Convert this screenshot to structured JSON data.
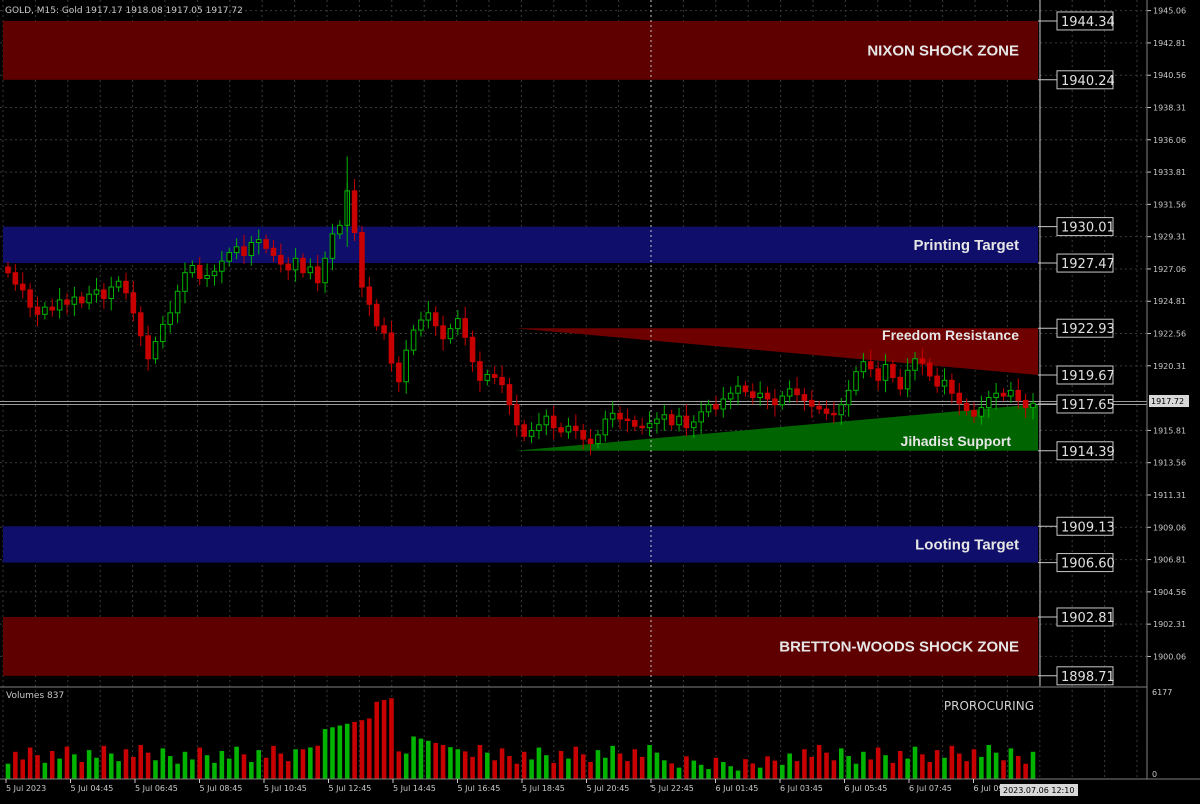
{
  "header": {
    "info": "GOLD, M15:  Gold  1917.17 1918.08 1917.05 1917.72"
  },
  "volume_panel": {
    "label": "Volumes 837",
    "watermark": "PROROCURING",
    "axis_max": "6177",
    "axis_min": "0"
  },
  "time_tag": "2023.07.06 12:10",
  "current_price_tag": "1917.72",
  "chart_data": {
    "type": "candlestick",
    "symbol": "GOLD",
    "timeframe": "M15",
    "ylim": [
      1898.0,
      1945.8
    ],
    "price_ticks": [
      "1945.06",
      "1942.81",
      "1940.56",
      "1938.31",
      "1936.06",
      "1933.81",
      "1931.56",
      "1929.31",
      "1927.06",
      "1924.81",
      "1922.56",
      "1920.31",
      "1915.81",
      "1913.56",
      "1911.31",
      "1909.06",
      "1906.81",
      "1904.56",
      "1902.31",
      "1900.06"
    ],
    "time_ticks": [
      "5 Jul 2023",
      "5 Jul 04:45",
      "5 Jul 06:45",
      "5 Jul 08:45",
      "5 Jul 10:45",
      "5 Jul 12:45",
      "5 Jul 14:45",
      "5 Jul 16:45",
      "5 Jul 18:45",
      "5 Jul 20:45",
      "5 Jul 22:45",
      "6 Jul 01:45",
      "6 Jul 03:45",
      "6 Jul 05:45",
      "6 Jul 07:45",
      "6 Jul 09:45"
    ],
    "zones": [
      {
        "label": "NIXON SHOCK ZONE",
        "high": 1944.34,
        "low": 1940.24,
        "color": "#5e0000",
        "text_color": "#e6e6e6",
        "high_label": "1944.34",
        "low_label": "1940.24"
      },
      {
        "label": "Printing Target",
        "high": 1930.01,
        "low": 1927.47,
        "color": "#0f0f6b",
        "text_color": "#e6e6e6",
        "high_label": "1930.01",
        "low_label": "1927.47"
      },
      {
        "label": "Looting Target",
        "high": 1909.13,
        "low": 1906.6,
        "color": "#0f0f6b",
        "text_color": "#e6e6e6",
        "high_label": "1909.13",
        "low_label": "1906.60"
      },
      {
        "label": "BRETTON-WOODS SHOCK ZONE",
        "high": 1902.81,
        "low": 1898.71,
        "color": "#5e0000",
        "text_color": "#e6e6e6",
        "high_label": "1902.81",
        "low_label": "1898.71"
      }
    ],
    "triangles": [
      {
        "label": "Freedom Resistance",
        "upper": 1922.93,
        "lower": 1919.67,
        "color": "#6e0000",
        "high_label": "1922.93",
        "low_label": "1919.67"
      },
      {
        "label": "Jihadist Support",
        "upper": 1917.65,
        "lower": 1914.39,
        "color": "#006400",
        "high_label": "1917.65",
        "low_label": "1914.39"
      }
    ],
    "current_price": 1917.72,
    "colors": {
      "bull": "#00b400",
      "bear": "#c80000",
      "grid": "#3a3a3a",
      "text": "#c8c8c8"
    }
  }
}
